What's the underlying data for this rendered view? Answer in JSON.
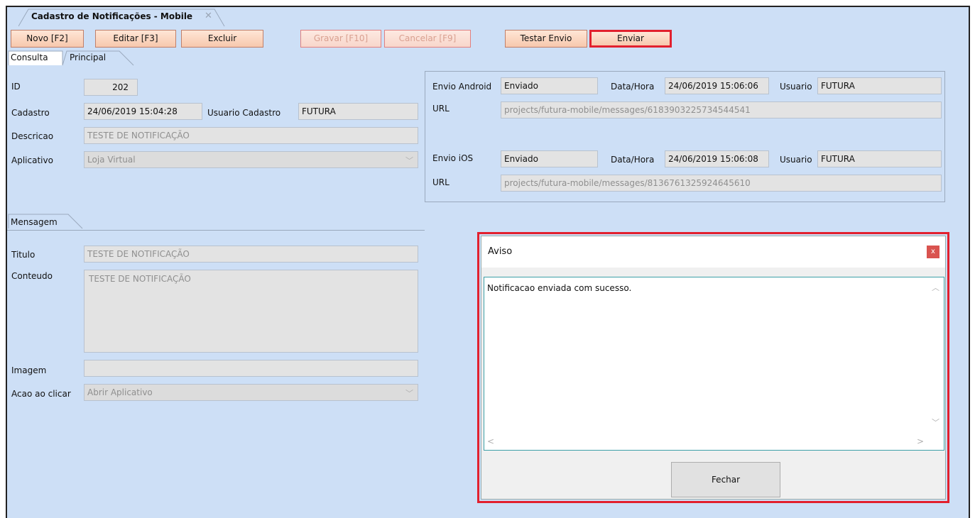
{
  "window": {
    "tab_title": "Cadastro de Notificações - Mobile",
    "tab_close_icon": "close-icon"
  },
  "toolbar": {
    "novo": "Novo [F2]",
    "editar": "Editar [F3]",
    "excluir": "Excluir",
    "gravar": "Gravar [F10]",
    "cancelar": "Cancelar [F9]",
    "testar_envio": "Testar Envio",
    "enviar": "Enviar"
  },
  "tabs": {
    "consulta": "Consulta",
    "principal": "Principal",
    "mensagem": "Mensagem"
  },
  "form": {
    "id_label": "ID",
    "id_value": "202",
    "cadastro_label": "Cadastro",
    "cadastro_value": "24/06/2019 15:04:28",
    "usuario_cadastro_label": "Usuario Cadastro",
    "usuario_cadastro_value": "FUTURA",
    "descricao_label": "Descricao",
    "descricao_value": "TESTE DE NOTIFICAÇÃO",
    "aplicativo_label": "Aplicativo",
    "aplicativo_value": "Loja Virtual"
  },
  "envio": {
    "android_label": "Envio Android",
    "android_status": "Enviado",
    "android_datahora_label": "Data/Hora",
    "android_datahora": "24/06/2019 15:06:06",
    "android_usuario_label": "Usuario",
    "android_usuario": "FUTURA",
    "android_url_label": "URL",
    "android_url": "projects/futura-mobile/messages/6183903225734544541",
    "ios_label": "Envio iOS",
    "ios_status": "Enviado",
    "ios_datahora_label": "Data/Hora",
    "ios_datahora": "24/06/2019 15:06:08",
    "ios_usuario_label": "Usuario",
    "ios_usuario": "FUTURA",
    "ios_url_label": "URL",
    "ios_url": "projects/futura-mobile/messages/8136761325924645610"
  },
  "mensagem": {
    "titulo_label": "Titulo",
    "titulo_value": "TESTE DE NOTIFICAÇÃO",
    "conteudo_label": "Conteudo",
    "conteudo_value": "TESTE DE NOTIFICAÇÃO",
    "imagem_label": "Imagem",
    "imagem_value": "",
    "acao_label": "Acao ao clicar",
    "acao_value": "Abrir Aplicativo"
  },
  "dialog": {
    "title": "Aviso",
    "close_label": "x",
    "message": "Notificacao enviada com sucesso.",
    "button": "Fechar"
  },
  "colors": {
    "background": "#cddff6",
    "highlight": "#e2202e",
    "button": "#f7c8ad"
  }
}
